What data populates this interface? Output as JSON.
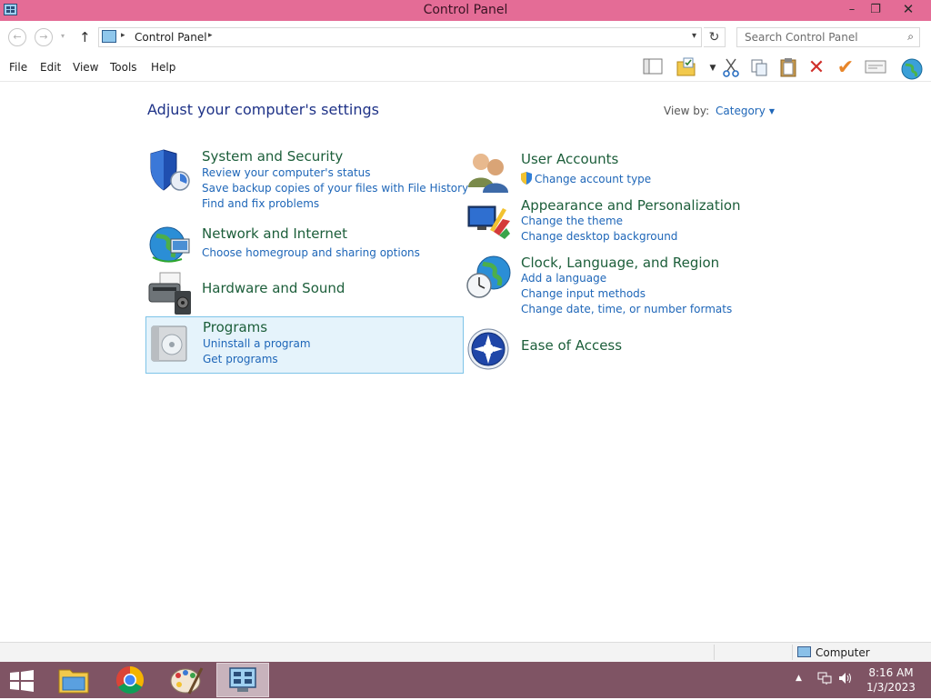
{
  "window": {
    "title": "Control Panel",
    "controls": {
      "minimize": "–",
      "maximize": "❐",
      "close": "✕"
    }
  },
  "nav": {
    "back": "←",
    "forward": "→",
    "recent": "▾",
    "up": "↑",
    "breadcrumb": [
      "Control Panel"
    ],
    "separator": "▸",
    "dropdown": "▾",
    "refresh": "↻",
    "search_placeholder": "Search Control Panel",
    "search_icon": "⌕"
  },
  "menu": [
    "File",
    "Edit",
    "View",
    "Tools",
    "Help"
  ],
  "toolbar_icons": [
    "layout-icon",
    "folder-icon",
    "dropdown-icon",
    "cut-icon",
    "copy-icon",
    "paste-icon",
    "delete-icon",
    "checkmark-icon",
    "properties-icon",
    "globe-icon"
  ],
  "content": {
    "heading": "Adjust your computer's settings",
    "view_by_label": "View by:",
    "view_by_value": "Category",
    "view_by_arrow": "▼"
  },
  "categories": {
    "system": {
      "title": "System and Security",
      "links": [
        "Review your computer's status",
        "Save backup copies of your files with File History",
        "Find and fix problems"
      ]
    },
    "network": {
      "title": "Network and Internet",
      "links": [
        "Choose homegroup and sharing options"
      ]
    },
    "hardware": {
      "title": "Hardware and Sound",
      "links": []
    },
    "programs": {
      "title": "Programs",
      "links": [
        "Uninstall a program",
        "Get programs"
      ]
    },
    "users": {
      "title": "User Accounts",
      "links": [
        "Change account type"
      ]
    },
    "appearance": {
      "title": "Appearance and Personalization",
      "links": [
        "Change the theme",
        "Change desktop background"
      ]
    },
    "clock": {
      "title": "Clock, Language, and Region",
      "links": [
        "Add a language",
        "Change input methods",
        "Change date, time, or number formats"
      ]
    },
    "ease": {
      "title": "Ease of Access",
      "links": []
    }
  },
  "status": {
    "location": "Computer"
  },
  "taskbar": {
    "apps": [
      "file-explorer",
      "chrome",
      "paint",
      "control-panel"
    ],
    "active_app": "control-panel",
    "tray_up": "▲",
    "time": "8:16 AM",
    "date": "1/3/2023"
  },
  "colors": {
    "titlebar": "#e46c96",
    "taskbar": "#7f5464",
    "heading": "#1e3287",
    "category_title": "#1c5e3a",
    "link": "#1e66b8",
    "highlight_bg": "#e5f3fb",
    "highlight_border": "#7ec4e8"
  }
}
